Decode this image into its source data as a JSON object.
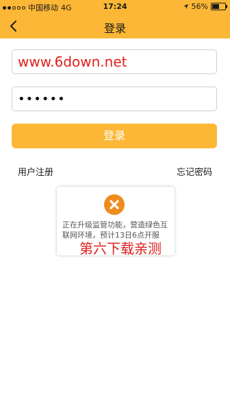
{
  "status_bar": {
    "carrier": "中国移动",
    "network": "4G",
    "time": "17:24",
    "battery": "56%",
    "battery_level": 0.56
  },
  "nav": {
    "title": "登录",
    "back_icon": "chevron-left-icon"
  },
  "form": {
    "username_value": "www.6down.net",
    "password_value": "••••••",
    "login_label": "登录"
  },
  "links": {
    "register": "用户注册",
    "forgot_password": "忘记密码"
  },
  "toast": {
    "icon": "close-circle-icon",
    "message": "正在升级监管功能，营造绿色互联网环境，预计13日6点开服"
  },
  "watermark": {
    "text": "第六下载亲测"
  },
  "colors": {
    "accent": "#fbb735",
    "error_icon": "#f08b1d",
    "watermark": "#e0201c"
  }
}
